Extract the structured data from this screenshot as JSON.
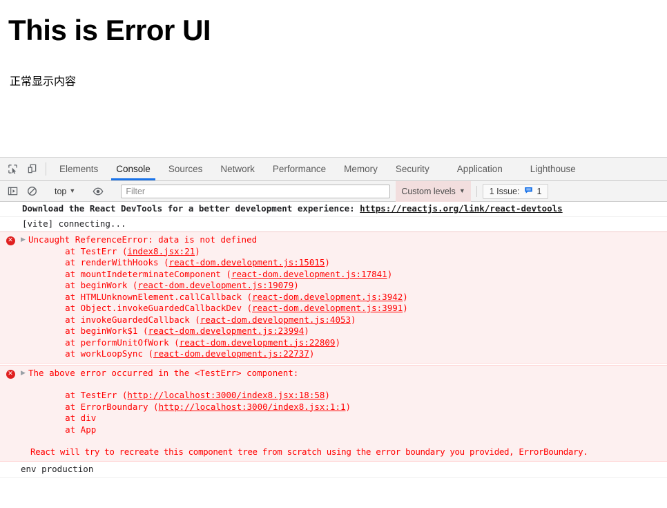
{
  "page": {
    "title": "This is Error UI",
    "paragraph": "正常显示内容"
  },
  "devtools": {
    "icons": {
      "inspect": "inspect-element-icon",
      "device": "device-toolbar-icon",
      "sidebar": "console-sidebar-icon",
      "clear": "clear-console-icon",
      "eye": "live-expression-eye-icon"
    },
    "tabs": [
      {
        "label": "Elements",
        "active": false
      },
      {
        "label": "Console",
        "active": true
      },
      {
        "label": "Sources",
        "active": false
      },
      {
        "label": "Network",
        "active": false
      },
      {
        "label": "Performance",
        "active": false
      },
      {
        "label": "Memory",
        "active": false
      },
      {
        "label": "Security",
        "active": false
      },
      {
        "label": "Application",
        "active": false
      },
      {
        "label": "Lighthouse",
        "active": false
      }
    ],
    "filterbar": {
      "context": "top",
      "context_caret": "▼",
      "filter_placeholder": "Filter",
      "filter_value": "",
      "levels_label": "Custom levels",
      "levels_caret": "▼",
      "issues_label": "1 Issue:",
      "issues_count": "1",
      "issues_icon": "issue-message-icon"
    },
    "console": {
      "messages": [
        {
          "type": "info-bold",
          "text": "Download the React DevTools for a better development experience: ",
          "link": "https://reactjs.org/link/react-devtools"
        },
        {
          "type": "info",
          "text": "[vite] connecting..."
        }
      ],
      "error_groups": [
        {
          "icon": "error-icon",
          "disclosure": "▶",
          "title": "Uncaught ReferenceError: data is not defined",
          "stack": [
            {
              "prefix": "    at TestErr (",
              "link": "index8.jsx:21",
              "suffix": ")"
            },
            {
              "prefix": "    at renderWithHooks (",
              "link": "react-dom.development.js:15015",
              "suffix": ")"
            },
            {
              "prefix": "    at mountIndeterminateComponent (",
              "link": "react-dom.development.js:17841",
              "suffix": ")"
            },
            {
              "prefix": "    at beginWork (",
              "link": "react-dom.development.js:19079",
              "suffix": ")"
            },
            {
              "prefix": "    at HTMLUnknownElement.callCallback (",
              "link": "react-dom.development.js:3942",
              "suffix": ")"
            },
            {
              "prefix": "    at Object.invokeGuardedCallbackDev (",
              "link": "react-dom.development.js:3991",
              "suffix": ")"
            },
            {
              "prefix": "    at invokeGuardedCallback (",
              "link": "react-dom.development.js:4053",
              "suffix": ")"
            },
            {
              "prefix": "    at beginWork$1 (",
              "link": "react-dom.development.js:23994",
              "suffix": ")"
            },
            {
              "prefix": "    at performUnitOfWork (",
              "link": "react-dom.development.js:22809",
              "suffix": ")"
            },
            {
              "prefix": "    at workLoopSync (",
              "link": "react-dom.development.js:22737",
              "suffix": ")"
            }
          ],
          "note": ""
        },
        {
          "icon": "error-icon",
          "disclosure": "▶",
          "title": "The above error occurred in the <TestErr> component:",
          "stack": [
            {
              "prefix": "    at TestErr (",
              "link": "http://localhost:3000/index8.jsx:18:58",
              "suffix": ")"
            },
            {
              "prefix": "    at ErrorBoundary (",
              "link": "http://localhost:3000/index8.jsx:1:1",
              "suffix": ")"
            },
            {
              "prefix": "    at div",
              "link": "",
              "suffix": ""
            },
            {
              "prefix": "    at App",
              "link": "",
              "suffix": ""
            }
          ],
          "note": "React will try to recreate this component tree from scratch using the error boundary you provided, ErrorBoundary."
        }
      ],
      "tail": "env production"
    }
  },
  "colors": {
    "accent": "#1a73e8",
    "error_text": "#ff0000",
    "error_bg": "#fdf0f0",
    "error_icon": "#e02020",
    "levels_bg": "#f2dede",
    "toolbar_bg": "#f3f3f3"
  }
}
